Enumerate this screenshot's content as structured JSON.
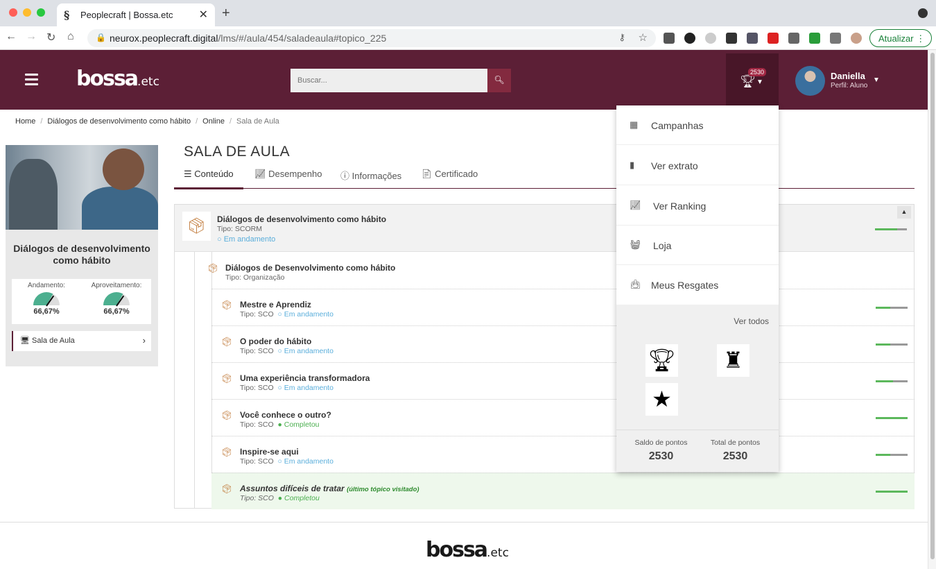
{
  "browser": {
    "tab_title": "Peoplecraft | Bossa.etc",
    "url_host": "neurox.peoplecraft.digital",
    "url_path": "/lms/#/aula/454/saladeaula#topico_225",
    "update_label": "Atualizar"
  },
  "header": {
    "logo_main": "bossa",
    "logo_suffix": ".etc",
    "search_placeholder": "Buscar...",
    "points_badge": "2530",
    "user_name": "Daniella",
    "user_role": "Perfil: Aluno"
  },
  "breadcrumb": [
    "Home",
    "Diálogos de desenvolvimento como hábito",
    "Online",
    "Sala de Aula"
  ],
  "course": {
    "title": "Diálogos de desenvolvimento como hábito",
    "progress_label": "Andamento:",
    "progress_value": "66,67%",
    "score_label": "Aproveitamento:",
    "score_value": "66,67%",
    "classroom_link": "Sala de Aula"
  },
  "page": {
    "title": "SALA DE AULA",
    "tabs": [
      "Conteúdo",
      "Desempenho",
      "Informações",
      "Certificado"
    ]
  },
  "tree": {
    "root": {
      "name": "Diálogos de desenvolvimento como hábito",
      "type": "Tipo: SCORM",
      "status": "Em andamento",
      "progress": 0.7
    },
    "org": {
      "name": "Diálogos de Desenvolvimento como hábito",
      "type": "Tipo: Organização"
    },
    "items": [
      {
        "name": "Mestre e Aprendiz",
        "type": "Tipo: SCO",
        "status": "Em andamento",
        "done": false,
        "progress": 0.45
      },
      {
        "name": "O poder do hábito",
        "type": "Tipo: SCO",
        "status": "Em andamento",
        "done": false,
        "progress": 0.45
      },
      {
        "name": "Uma experiência transformadora",
        "type": "Tipo: SCO",
        "status": "Em andamento",
        "done": false,
        "progress": 0.55
      },
      {
        "name": "Você conhece o outro?",
        "type": "Tipo: SCO",
        "status": "Completou",
        "done": true,
        "progress": 1
      },
      {
        "name": "Inspire-se aqui",
        "type": "Tipo: SCO",
        "status": "Em andamento",
        "done": false,
        "progress": 0.45
      },
      {
        "name": "Assuntos difíceis de tratar",
        "type": "Tipo: SCO",
        "status": "Completou",
        "done": true,
        "progress": 1,
        "note": "(último tópico visitado)"
      }
    ]
  },
  "dropdown": {
    "items": [
      "Campanhas",
      "Ver extrato",
      "Ver Ranking",
      "Loja",
      "Meus Resgates"
    ],
    "see_all": "Ver todos",
    "balance_label": "Saldo de pontos",
    "balance_value": "2530",
    "total_label": "Total de pontos",
    "total_value": "2530"
  },
  "footer": {
    "logo_main": "bossa",
    "logo_suffix": ".etc"
  }
}
